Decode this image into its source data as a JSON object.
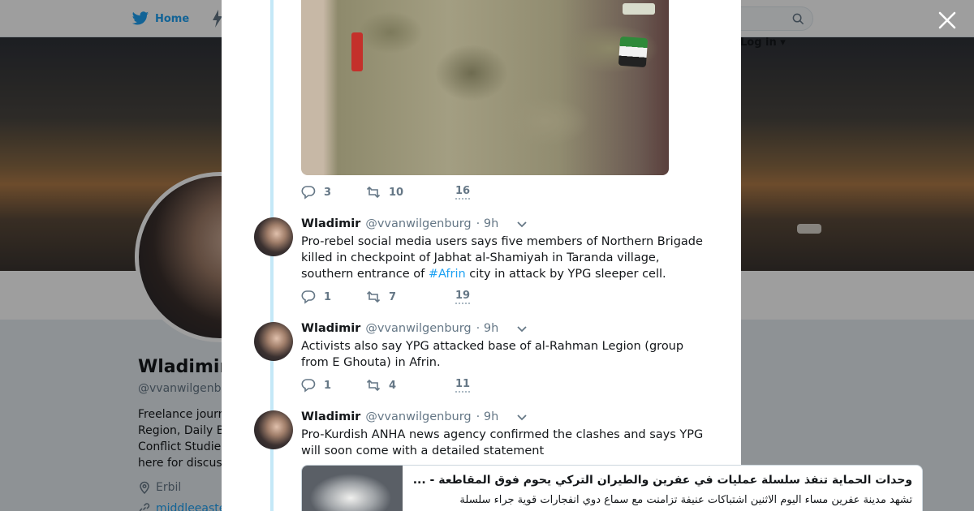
{
  "nav": {
    "home_label": "Home",
    "login_label": "Log in"
  },
  "profile": {
    "name": "Wladimir",
    "handle": "@vvanwilgenb",
    "bio_lines": [
      "Freelance journ",
      "Region, Daily B",
      "Conflict Studie",
      "here for discus"
    ],
    "location": "Erbil",
    "url": "middleeaste"
  },
  "first_tweet_counts": {
    "replies": "3",
    "retweets": "10",
    "likes": "16"
  },
  "tweets": [
    {
      "name": "Wladimir",
      "handle": "@vvanwilgenburg",
      "time": "· 9h",
      "text_before": "Pro-rebel social media users says five members of Northern Brigade killed in checkpoint of Jabhat al-Shamiyah in Taranda village, southern entrance of ",
      "hashtag": "#Afrin",
      "text_after": " city in attack by YPG sleeper cell.",
      "replies": "1",
      "retweets": "7",
      "likes": "19"
    },
    {
      "name": "Wladimir",
      "handle": "@vvanwilgenburg",
      "time": "· 9h",
      "text": "Activists also say YPG attacked base of al-Rahman Legion (group from E Ghouta) in Afrin.",
      "replies": "1",
      "retweets": "4",
      "likes": "11"
    },
    {
      "name": "Wladimir",
      "handle": "@vvanwilgenburg",
      "time": "· 9h",
      "text": "Pro-Kurdish ANHA news agency confirmed the clashes and says YPG will soon come with a detailed statement"
    }
  ],
  "link_card": {
    "title": "وحدات الحماية تنفذ سلسلة عمليات في عفرين والطيران التركي يحوم فوق المقاطعة - ...",
    "description": "تشهد مدينة عفرين مساء اليوم الاثنين اشتباكات عنيفة تزامنت مع سماع دوي انفجارات قوية جراء سلسلة"
  }
}
